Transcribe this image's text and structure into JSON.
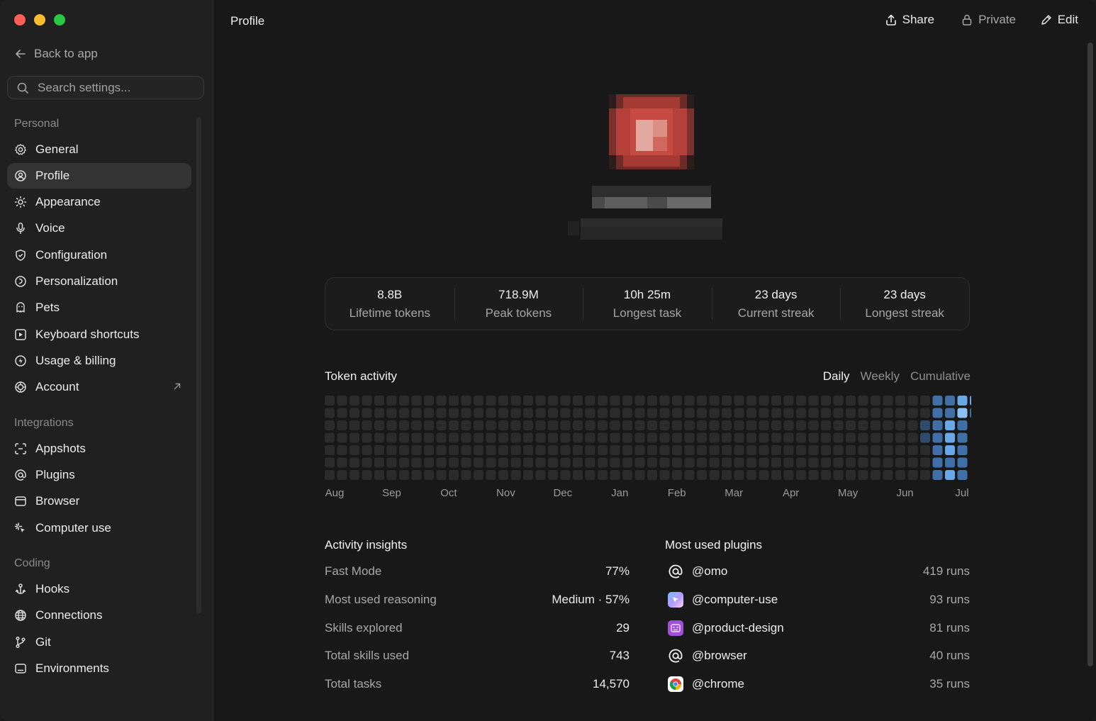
{
  "sidebar": {
    "back_label": "Back to app",
    "search_placeholder": "Search settings...",
    "sections": {
      "personal": "Personal",
      "integrations": "Integrations",
      "coding": "Coding"
    },
    "personal_items": [
      {
        "label": "General",
        "icon": "gear-icon"
      },
      {
        "label": "Profile",
        "icon": "user-circle-icon"
      },
      {
        "label": "Appearance",
        "icon": "sun-icon"
      },
      {
        "label": "Voice",
        "icon": "microphone-icon"
      },
      {
        "label": "Configuration",
        "icon": "shield-icon"
      },
      {
        "label": "Personalization",
        "icon": "personalization-icon"
      },
      {
        "label": "Pets",
        "icon": "pet-icon"
      },
      {
        "label": "Keyboard shortcuts",
        "icon": "keyboard-icon"
      },
      {
        "label": "Usage & billing",
        "icon": "usage-icon"
      },
      {
        "label": "Account",
        "icon": "account-icon"
      }
    ],
    "integration_items": [
      {
        "label": "Appshots",
        "icon": "appshots-icon"
      },
      {
        "label": "Plugins",
        "icon": "at-icon"
      },
      {
        "label": "Browser",
        "icon": "browser-icon"
      },
      {
        "label": "Computer use",
        "icon": "sparkle-cursor-icon"
      }
    ],
    "coding_items": [
      {
        "label": "Hooks",
        "icon": "hook-icon"
      },
      {
        "label": "Connections",
        "icon": "globe-icon"
      },
      {
        "label": "Git",
        "icon": "git-branch-icon"
      },
      {
        "label": "Environments",
        "icon": "terminal-icon"
      }
    ],
    "active": "Profile"
  },
  "header": {
    "title": "Profile",
    "share_label": "Share",
    "private_label": "Private",
    "edit_label": "Edit"
  },
  "stats": [
    {
      "value": "8.8B",
      "label": "Lifetime tokens"
    },
    {
      "value": "718.9M",
      "label": "Peak tokens"
    },
    {
      "value": "10h 25m",
      "label": "Longest task"
    },
    {
      "value": "23 days",
      "label": "Current streak"
    },
    {
      "value": "23 days",
      "label": "Longest streak"
    }
  ],
  "token_activity": {
    "title": "Token activity",
    "tabs": [
      "Daily",
      "Weekly",
      "Cumulative"
    ],
    "selected_tab": "Daily",
    "months": [
      "Aug",
      "Sep",
      "Oct",
      "Nov",
      "Dec",
      "Jan",
      "Feb",
      "Mar",
      "Apr",
      "May",
      "Jun",
      "Jul"
    ],
    "colors": {
      "empty": "#2b2b2b",
      "low": "#2f4a6a",
      "mid": "#3f6fa6",
      "high": "#6aa7e6",
      "max": "#8cc3f4"
    }
  },
  "insights": {
    "title": "Activity insights",
    "rows": [
      {
        "label": "Fast Mode",
        "value": "77%"
      },
      {
        "label": "Most used reasoning",
        "value": "Medium · 57%"
      },
      {
        "label": "Skills explored",
        "value": "29"
      },
      {
        "label": "Total skills used",
        "value": "743"
      },
      {
        "label": "Total tasks",
        "value": "14,570"
      }
    ]
  },
  "plugins": {
    "title": "Most used plugins",
    "rows": [
      {
        "name": "@omo",
        "runs": "419 runs",
        "icon": "at-icon"
      },
      {
        "name": "@computer-use",
        "runs": "93 runs",
        "icon": "computer-use-plugin-icon"
      },
      {
        "name": "@product-design",
        "runs": "81 runs",
        "icon": "product-design-plugin-icon"
      },
      {
        "name": "@browser",
        "runs": "40 runs",
        "icon": "at-icon"
      },
      {
        "name": "@chrome",
        "runs": "35 runs",
        "icon": "chrome-icon"
      }
    ]
  }
}
